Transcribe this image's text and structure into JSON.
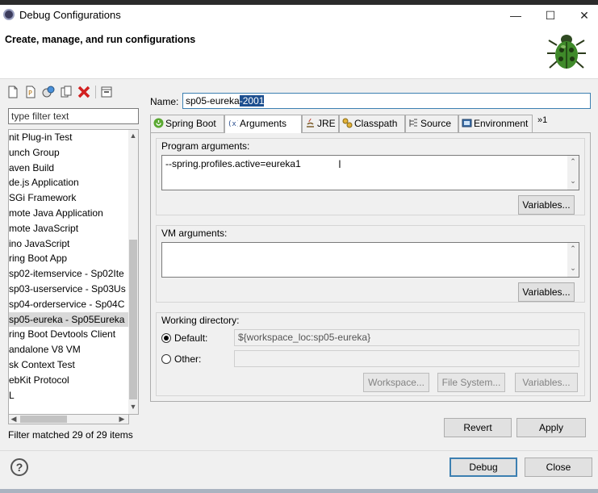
{
  "window": {
    "title": "Debug Configurations",
    "minimize": "—",
    "maximize": "☐",
    "close": "✕"
  },
  "header": {
    "subtitle": "Create, manage, and run configurations"
  },
  "toolbar": {
    "new_icon": "new-configuration-icon",
    "new_proto_icon": "new-prototype-icon",
    "export_icon": "export-icon",
    "duplicate_icon": "duplicate-icon",
    "delete_icon": "delete-icon",
    "collapse_icon": "collapse-all-icon"
  },
  "filter": {
    "placeholder": "type filter text",
    "status": "Filter matched 29 of 29 items"
  },
  "tree": {
    "items": [
      {
        "label": "nit Plug-in Test",
        "selected": false
      },
      {
        "label": "unch Group",
        "selected": false
      },
      {
        "label": "aven Build",
        "selected": false
      },
      {
        "label": "de.js Application",
        "selected": false
      },
      {
        "label": "SGi Framework",
        "selected": false
      },
      {
        "label": "mote Java Application",
        "selected": false
      },
      {
        "label": "mote JavaScript",
        "selected": false
      },
      {
        "label": "ino JavaScript",
        "selected": false
      },
      {
        "label": "ring Boot App",
        "selected": false
      },
      {
        "label": "sp02-itemservice - Sp02Ite",
        "selected": false
      },
      {
        "label": "sp03-userservice - Sp03Us",
        "selected": false
      },
      {
        "label": "sp04-orderservice - Sp04C",
        "selected": false
      },
      {
        "label": "sp05-eureka - Sp05Eureka",
        "selected": true
      },
      {
        "label": "ring Boot Devtools Client",
        "selected": false
      },
      {
        "label": "andalone V8 VM",
        "selected": false
      },
      {
        "label": "sk Context Test",
        "selected": false
      },
      {
        "label": "ebKit Protocol",
        "selected": false
      },
      {
        "label": "L",
        "selected": false
      }
    ]
  },
  "config": {
    "name_label": "Name:",
    "name_value": "sp05-eureka",
    "name_selected": "-2001",
    "tabs": [
      {
        "label": "Spring Boot",
        "icon": "spring-icon",
        "active": false
      },
      {
        "label": "Arguments",
        "icon": "arguments-icon",
        "active": true
      },
      {
        "label": "JRE",
        "icon": "jre-icon",
        "active": false
      },
      {
        "label": "Classpath",
        "icon": "classpath-icon",
        "active": false
      },
      {
        "label": "Source",
        "icon": "source-icon",
        "active": false
      },
      {
        "label": "Environment",
        "icon": "environment-icon",
        "active": false
      }
    ],
    "more_tabs": "»1",
    "program_args": {
      "title": "Program arguments:",
      "value": "--spring.profiles.active=eureka1",
      "variables": "Variables..."
    },
    "vm_args": {
      "title": "VM arguments:",
      "value": "",
      "variables": "Variables..."
    },
    "working_dir": {
      "title": "Working directory:",
      "default_label": "Default:",
      "default_value": "${workspace_loc:sp05-eureka}",
      "other_label": "Other:",
      "other_value": "",
      "selected": "default",
      "workspace_btn": "Workspace...",
      "filesystem_btn": "File System...",
      "variables_btn": "Variables..."
    },
    "revert": "Revert",
    "apply": "Apply"
  },
  "footer": {
    "help": "?",
    "debug": "Debug",
    "close": "Close"
  },
  "colors": {
    "selection": "#1d4f8f",
    "focus_border": "#3c7fb1",
    "delete_red": "#d22020"
  }
}
